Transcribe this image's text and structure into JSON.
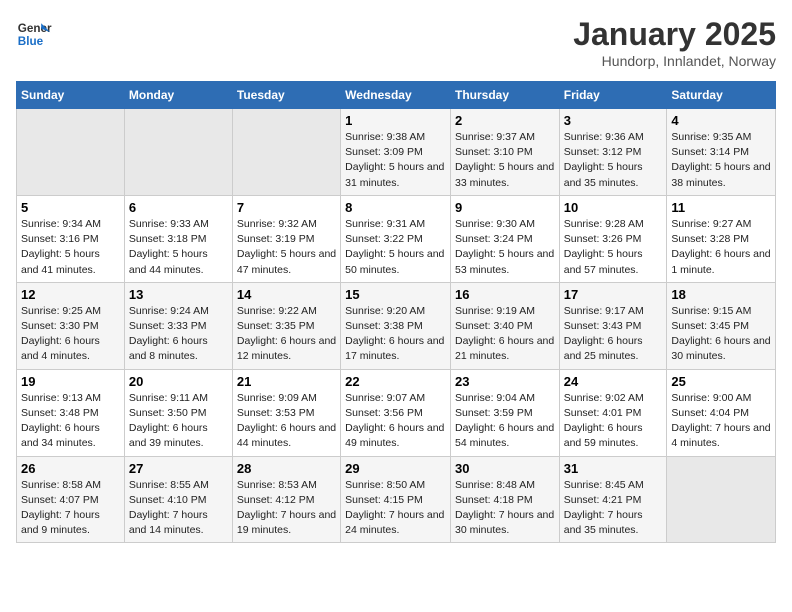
{
  "header": {
    "logo_line1": "General",
    "logo_line2": "Blue",
    "title": "January 2025",
    "subtitle": "Hundorp, Innlandet, Norway"
  },
  "weekdays": [
    "Sunday",
    "Monday",
    "Tuesday",
    "Wednesday",
    "Thursday",
    "Friday",
    "Saturday"
  ],
  "weeks": [
    [
      {
        "day": "",
        "info": ""
      },
      {
        "day": "",
        "info": ""
      },
      {
        "day": "",
        "info": ""
      },
      {
        "day": "1",
        "info": "Sunrise: 9:38 AM\nSunset: 3:09 PM\nDaylight: 5 hours and 31 minutes."
      },
      {
        "day": "2",
        "info": "Sunrise: 9:37 AM\nSunset: 3:10 PM\nDaylight: 5 hours and 33 minutes."
      },
      {
        "day": "3",
        "info": "Sunrise: 9:36 AM\nSunset: 3:12 PM\nDaylight: 5 hours and 35 minutes."
      },
      {
        "day": "4",
        "info": "Sunrise: 9:35 AM\nSunset: 3:14 PM\nDaylight: 5 hours and 38 minutes."
      }
    ],
    [
      {
        "day": "5",
        "info": "Sunrise: 9:34 AM\nSunset: 3:16 PM\nDaylight: 5 hours and 41 minutes."
      },
      {
        "day": "6",
        "info": "Sunrise: 9:33 AM\nSunset: 3:18 PM\nDaylight: 5 hours and 44 minutes."
      },
      {
        "day": "7",
        "info": "Sunrise: 9:32 AM\nSunset: 3:19 PM\nDaylight: 5 hours and 47 minutes."
      },
      {
        "day": "8",
        "info": "Sunrise: 9:31 AM\nSunset: 3:22 PM\nDaylight: 5 hours and 50 minutes."
      },
      {
        "day": "9",
        "info": "Sunrise: 9:30 AM\nSunset: 3:24 PM\nDaylight: 5 hours and 53 minutes."
      },
      {
        "day": "10",
        "info": "Sunrise: 9:28 AM\nSunset: 3:26 PM\nDaylight: 5 hours and 57 minutes."
      },
      {
        "day": "11",
        "info": "Sunrise: 9:27 AM\nSunset: 3:28 PM\nDaylight: 6 hours and 1 minute."
      }
    ],
    [
      {
        "day": "12",
        "info": "Sunrise: 9:25 AM\nSunset: 3:30 PM\nDaylight: 6 hours and 4 minutes."
      },
      {
        "day": "13",
        "info": "Sunrise: 9:24 AM\nSunset: 3:33 PM\nDaylight: 6 hours and 8 minutes."
      },
      {
        "day": "14",
        "info": "Sunrise: 9:22 AM\nSunset: 3:35 PM\nDaylight: 6 hours and 12 minutes."
      },
      {
        "day": "15",
        "info": "Sunrise: 9:20 AM\nSunset: 3:38 PM\nDaylight: 6 hours and 17 minutes."
      },
      {
        "day": "16",
        "info": "Sunrise: 9:19 AM\nSunset: 3:40 PM\nDaylight: 6 hours and 21 minutes."
      },
      {
        "day": "17",
        "info": "Sunrise: 9:17 AM\nSunset: 3:43 PM\nDaylight: 6 hours and 25 minutes."
      },
      {
        "day": "18",
        "info": "Sunrise: 9:15 AM\nSunset: 3:45 PM\nDaylight: 6 hours and 30 minutes."
      }
    ],
    [
      {
        "day": "19",
        "info": "Sunrise: 9:13 AM\nSunset: 3:48 PM\nDaylight: 6 hours and 34 minutes."
      },
      {
        "day": "20",
        "info": "Sunrise: 9:11 AM\nSunset: 3:50 PM\nDaylight: 6 hours and 39 minutes."
      },
      {
        "day": "21",
        "info": "Sunrise: 9:09 AM\nSunset: 3:53 PM\nDaylight: 6 hours and 44 minutes."
      },
      {
        "day": "22",
        "info": "Sunrise: 9:07 AM\nSunset: 3:56 PM\nDaylight: 6 hours and 49 minutes."
      },
      {
        "day": "23",
        "info": "Sunrise: 9:04 AM\nSunset: 3:59 PM\nDaylight: 6 hours and 54 minutes."
      },
      {
        "day": "24",
        "info": "Sunrise: 9:02 AM\nSunset: 4:01 PM\nDaylight: 6 hours and 59 minutes."
      },
      {
        "day": "25",
        "info": "Sunrise: 9:00 AM\nSunset: 4:04 PM\nDaylight: 7 hours and 4 minutes."
      }
    ],
    [
      {
        "day": "26",
        "info": "Sunrise: 8:58 AM\nSunset: 4:07 PM\nDaylight: 7 hours and 9 minutes."
      },
      {
        "day": "27",
        "info": "Sunrise: 8:55 AM\nSunset: 4:10 PM\nDaylight: 7 hours and 14 minutes."
      },
      {
        "day": "28",
        "info": "Sunrise: 8:53 AM\nSunset: 4:12 PM\nDaylight: 7 hours and 19 minutes."
      },
      {
        "day": "29",
        "info": "Sunrise: 8:50 AM\nSunset: 4:15 PM\nDaylight: 7 hours and 24 minutes."
      },
      {
        "day": "30",
        "info": "Sunrise: 8:48 AM\nSunset: 4:18 PM\nDaylight: 7 hours and 30 minutes."
      },
      {
        "day": "31",
        "info": "Sunrise: 8:45 AM\nSunset: 4:21 PM\nDaylight: 7 hours and 35 minutes."
      },
      {
        "day": "",
        "info": ""
      }
    ]
  ]
}
